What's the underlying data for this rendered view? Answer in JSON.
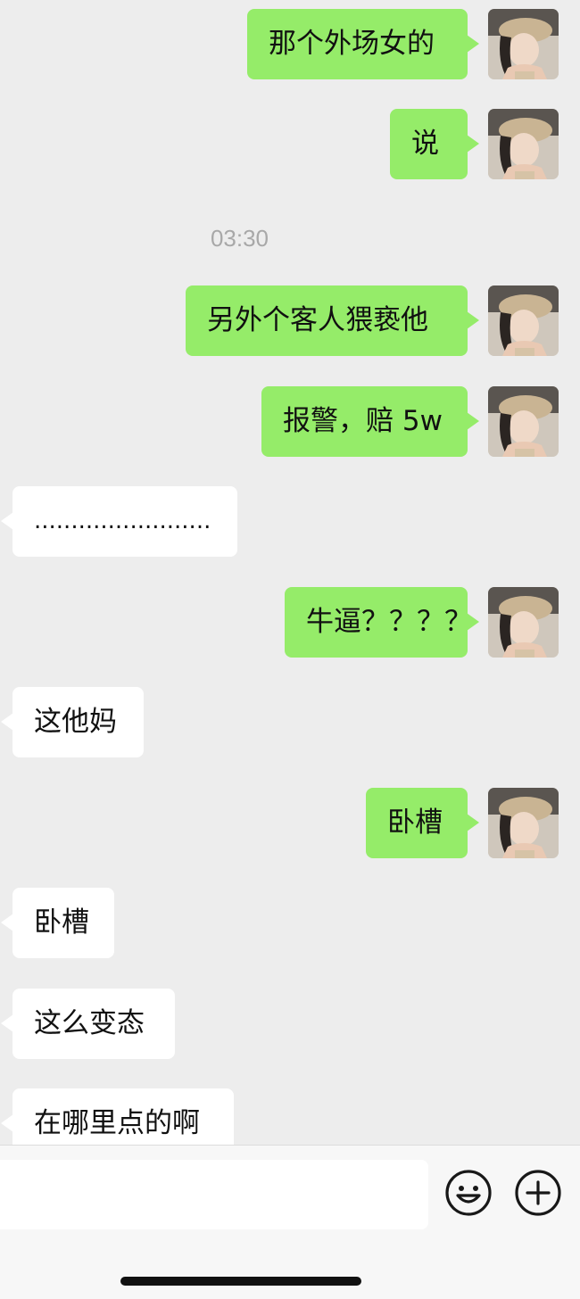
{
  "conversation": {
    "messages": [
      {
        "sender": "me",
        "text": "那个外场女的"
      },
      {
        "sender": "me",
        "text": "说"
      },
      {
        "type": "timestamp",
        "text": "03:30"
      },
      {
        "sender": "me",
        "text": "另外个客人猥亵他"
      },
      {
        "sender": "me",
        "text": "报警，赔 5w"
      },
      {
        "sender": "other",
        "text": "........................"
      },
      {
        "sender": "me",
        "text": "牛逼？？？？"
      },
      {
        "sender": "other",
        "text": "这他妈"
      },
      {
        "sender": "me",
        "text": "卧槽"
      },
      {
        "sender": "other",
        "text": "卧槽"
      },
      {
        "sender": "other",
        "text": "这么变态"
      },
      {
        "sender": "other",
        "text": "在哪里点的啊"
      }
    ]
  },
  "input_bar": {
    "message_input_value": "",
    "emoji_icon": "smiley-face-icon",
    "more_icon": "plus-circle-icon"
  },
  "colors": {
    "background": "#ededed",
    "sent_bubble": "#95ec69",
    "received_bubble": "#ffffff",
    "timestamp_text": "#a8a8a8"
  }
}
